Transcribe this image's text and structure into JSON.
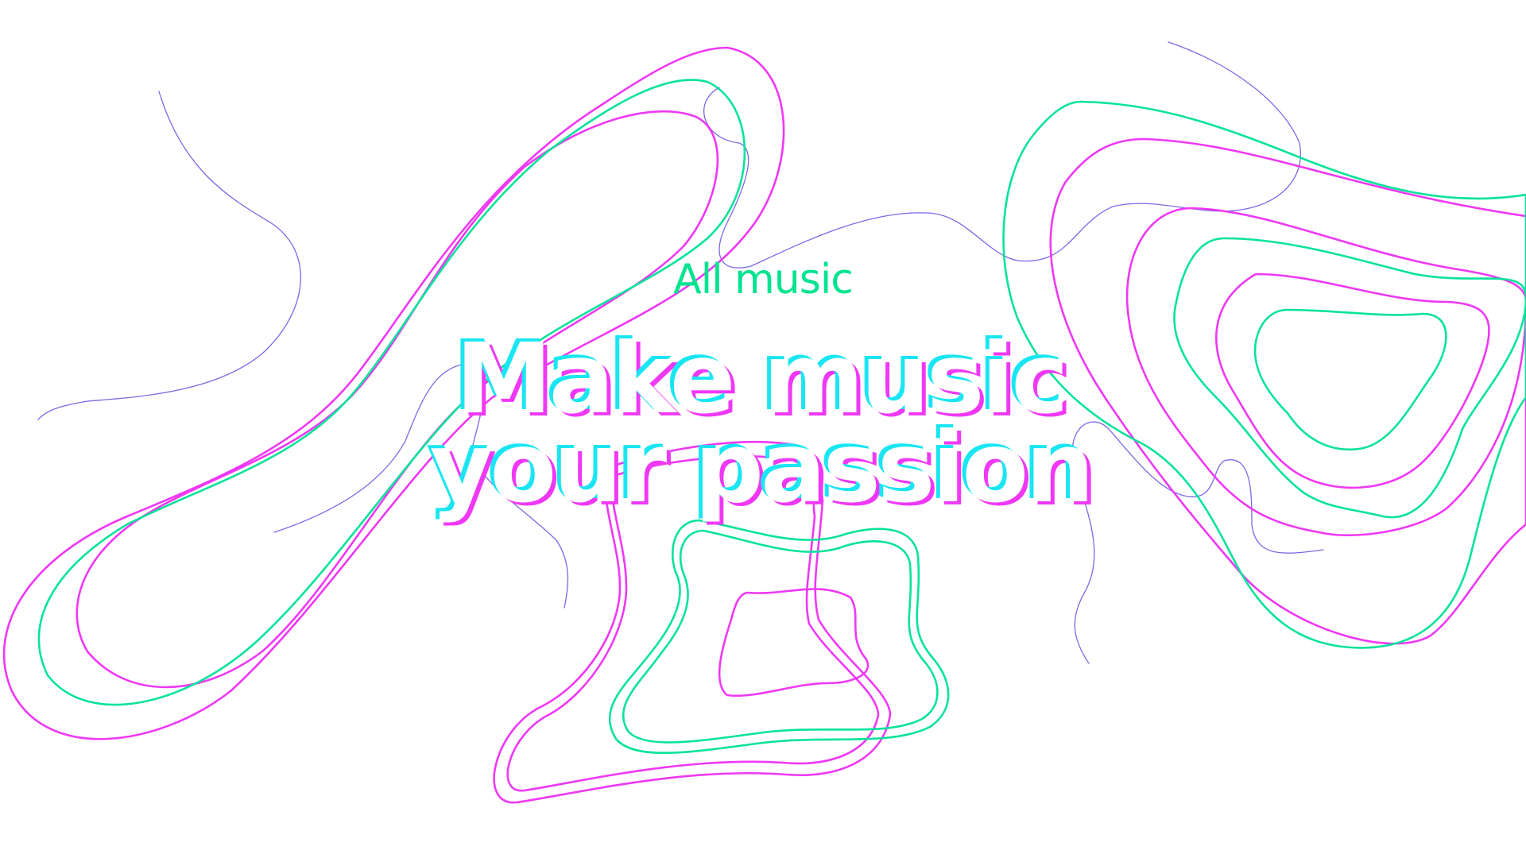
{
  "hero": {
    "eyebrow": "All music",
    "headline_line1": "Make music",
    "headline_line2": "your passion"
  },
  "colors": {
    "magenta": "#ef38f5",
    "green": "#08e39a",
    "violet": "#7b68e6",
    "cyan": "#19e6f2",
    "background": "#ffffff"
  }
}
